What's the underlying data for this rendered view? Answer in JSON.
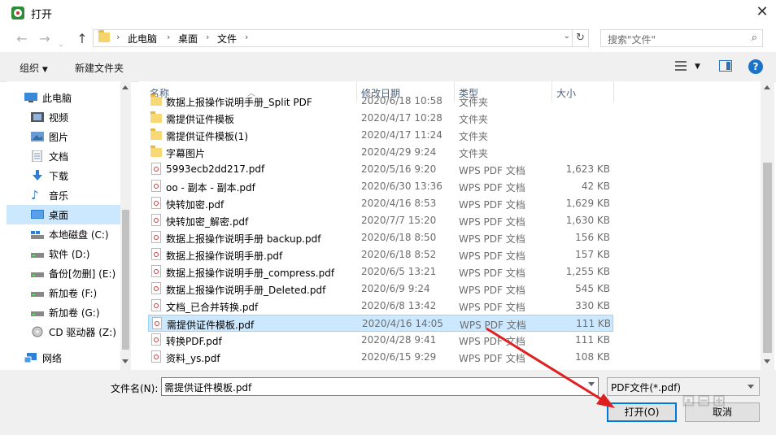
{
  "window": {
    "title": "打开"
  },
  "address": {
    "crumbs": [
      "此电脑",
      "桌面",
      "文件"
    ],
    "search_placeholder": "搜索\"文件\""
  },
  "toolbar": {
    "organize": "组织",
    "new_folder": "新建文件夹"
  },
  "sidebar": {
    "items": [
      {
        "label": "此电脑",
        "icon": "computer-icon"
      },
      {
        "label": "视频",
        "icon": "video-icon"
      },
      {
        "label": "图片",
        "icon": "picture-icon"
      },
      {
        "label": "文档",
        "icon": "document-icon"
      },
      {
        "label": "下载",
        "icon": "download-icon"
      },
      {
        "label": "音乐",
        "icon": "music-icon"
      },
      {
        "label": "桌面",
        "icon": "desktop-icon"
      },
      {
        "label": "本地磁盘 (C:)",
        "icon": "drive-icon"
      },
      {
        "label": "软件 (D:)",
        "icon": "drive-icon"
      },
      {
        "label": "备份[勿删] (E:)",
        "icon": "drive-icon"
      },
      {
        "label": "新加卷 (F:)",
        "icon": "drive-icon"
      },
      {
        "label": "新加卷 (G:)",
        "icon": "drive-icon"
      },
      {
        "label": "CD 驱动器 (Z:)",
        "icon": "cd-drive-icon"
      },
      {
        "label": "网络",
        "icon": "network-icon"
      }
    ]
  },
  "columns": {
    "name": "名称",
    "date": "修改日期",
    "type": "类型",
    "size": "大小"
  },
  "files": [
    {
      "name": "数据上报操作说明手册_Split PDF",
      "date": "2020/6/18 10:58",
      "type": "文件夹",
      "size": "",
      "kind": "folder"
    },
    {
      "name": "需提供证件模板",
      "date": "2020/4/17 10:28",
      "type": "文件夹",
      "size": "",
      "kind": "folder"
    },
    {
      "name": "需提供证件模板(1)",
      "date": "2020/4/17 11:24",
      "type": "文件夹",
      "size": "",
      "kind": "folder"
    },
    {
      "name": "字幕图片",
      "date": "2020/4/29 9:24",
      "type": "文件夹",
      "size": "",
      "kind": "folder"
    },
    {
      "name": "5993ecb2dd217.pdf",
      "date": "2020/5/16 9:20",
      "type": "WPS PDF 文档",
      "size": "1,623 KB",
      "kind": "pdf"
    },
    {
      "name": "oo - 副本 - 副本.pdf",
      "date": "2020/6/30 13:36",
      "type": "WPS PDF 文档",
      "size": "42 KB",
      "kind": "pdf"
    },
    {
      "name": "快转加密.pdf",
      "date": "2020/4/16 8:53",
      "type": "WPS PDF 文档",
      "size": "1,629 KB",
      "kind": "pdf"
    },
    {
      "name": "快转加密_解密.pdf",
      "date": "2020/7/7 15:20",
      "type": "WPS PDF 文档",
      "size": "1,630 KB",
      "kind": "pdf"
    },
    {
      "name": "数据上报操作说明手册 backup.pdf",
      "date": "2020/6/18 8:50",
      "type": "WPS PDF 文档",
      "size": "156 KB",
      "kind": "pdf"
    },
    {
      "name": "数据上报操作说明手册.pdf",
      "date": "2020/6/18 8:52",
      "type": "WPS PDF 文档",
      "size": "157 KB",
      "kind": "pdf"
    },
    {
      "name": "数据上报操作说明手册_compress.pdf",
      "date": "2020/6/5 13:21",
      "type": "WPS PDF 文档",
      "size": "1,255 KB",
      "kind": "pdf"
    },
    {
      "name": "数据上报操作说明手册_Deleted.pdf",
      "date": "2020/6/9 9:24",
      "type": "WPS PDF 文档",
      "size": "545 KB",
      "kind": "pdf"
    },
    {
      "name": "文档_已合并转换.pdf",
      "date": "2020/6/8 13:42",
      "type": "WPS PDF 文档",
      "size": "330 KB",
      "kind": "pdf"
    },
    {
      "name": "需提供证件模板.pdf",
      "date": "2020/4/16 14:05",
      "type": "WPS PDF 文档",
      "size": "111 KB",
      "kind": "pdf",
      "selected": true
    },
    {
      "name": "转换PDF.pdf",
      "date": "2020/4/28 9:41",
      "type": "WPS PDF 文档",
      "size": "111 KB",
      "kind": "pdf"
    },
    {
      "name": "资料_ys.pdf",
      "date": "2020/6/15 9:29",
      "type": "WPS PDF 文档",
      "size": "108 KB",
      "kind": "pdf"
    }
  ],
  "filename": {
    "label": "文件名(N):",
    "value": "需提供证件模板.pdf"
  },
  "filetype": {
    "value": "PDF文件(*.pdf)"
  },
  "buttons": {
    "open": "打开(O)",
    "cancel": "取消"
  },
  "colors": {
    "selection": "#cce8ff",
    "accent": "#0078d7",
    "arrow": "#e02020"
  }
}
